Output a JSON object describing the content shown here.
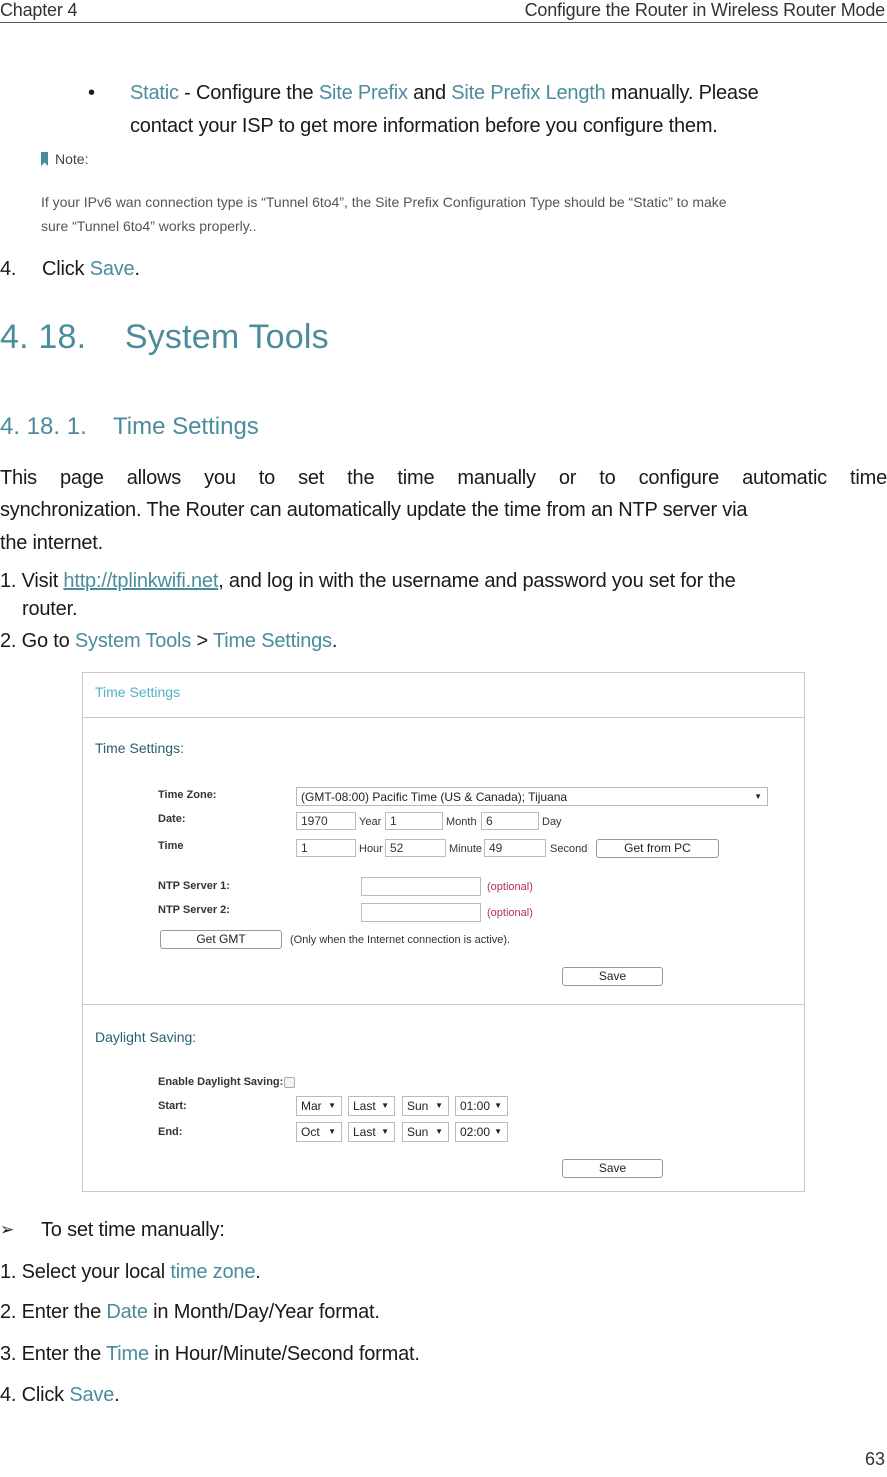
{
  "header": {
    "chapter": "Chapter 4",
    "title": "Configure the Router in Wireless Router Mode"
  },
  "bullet_static": {
    "bullet": "•",
    "term": "Static",
    "t1": " - Configure the ",
    "site_prefix": "Site Prefix",
    "t2": " and ",
    "site_prefix_length": "Site Prefix Length",
    "t3": " manually. Please",
    "line2": "contact your ISP to get more information before you configure them."
  },
  "note": {
    "label": "Note:",
    "line1": " If your IPv6 wan connection type is “Tunnel 6to4”, the Site Prefix Configuration Type should be “Static” to make",
    "line2": "sure “Tunnel 6to4” works properly.."
  },
  "step4_top": {
    "num": "4.",
    "text": "Click ",
    "link": "Save",
    "end": "."
  },
  "section": {
    "title": "4. 18.    System Tools"
  },
  "subsection": {
    "title": "4. 18. 1.    Time Settings"
  },
  "intro": {
    "line1": "This page allows you to set the time manually or to configure automatic time",
    "line2": "synchronization. The Router can automatically update the time from an NTP server via",
    "line3": "the internet."
  },
  "steps": {
    "s1_pre": "1. Visit ",
    "s1_link": "http://tplinkwifi.net",
    "s1_post": ", and log in with the username and password you set for the",
    "s1_line2": "router.",
    "s2_pre": "2. Go to ",
    "s2_a": "System Tools",
    "s2_sep": " > ",
    "s2_b": "Time Settings",
    "s2_end": "."
  },
  "ui": {
    "title": "Time Settings",
    "section_time": "Time Settings:",
    "time_zone_label": "Time Zone:",
    "time_zone_value": "(GMT-08:00) Pacific Time (US & Canada); Tijuana",
    "date_label": "Date:",
    "date_year": "1970",
    "year_unit": "Year",
    "date_month": "1",
    "month_unit": "Month",
    "date_day": "6",
    "day_unit": "Day",
    "time_label": "Time",
    "time_hour": "1",
    "hour_unit": "Hour",
    "time_minute": "52",
    "minute_unit": "Minute",
    "time_second": "49",
    "second_unit": "Second",
    "get_from_pc": "Get from PC",
    "ntp1_label": "NTP Server 1:",
    "ntp1_value": "",
    "ntp2_label": "NTP Server 2:",
    "ntp2_value": "",
    "optional": "(optional)",
    "get_gmt": "Get GMT",
    "gmt_hint": "(Only when the Internet connection is active).",
    "save": "Save",
    "section_dst": "Daylight Saving:",
    "enable_dst_label": "Enable Daylight Saving:",
    "enable_dst_checked": false,
    "start_label": "Start:",
    "start_month": "Mar",
    "start_week": "Last",
    "start_day": "Sun",
    "start_time": "01:00",
    "end_label": "End:",
    "end_month": "Oct",
    "end_week": "Last",
    "end_day": "Sun",
    "end_time": "02:00",
    "arrow": "▼"
  },
  "manual": {
    "arrow": "➢",
    "heading": "To set time manually:",
    "m1_pre": "1. Select your local ",
    "m1_link": "time zone",
    "m1_end": ".",
    "m2_pre": "2. Enter the ",
    "m2_link": "Date",
    "m2_end": " in Month/Day/Year format.",
    "m3_pre": "3. Enter the ",
    "m3_link": "Time",
    "m3_end": " in Hour/Minute/Second format.",
    "m4_pre": "4. Click ",
    "m4_link": "Save",
    "m4_end": "."
  },
  "page_number": "63",
  "colors": {
    "accent": "#4a8c9c",
    "ui_title": "#4fb3c8",
    "optional": "#b0305a"
  }
}
